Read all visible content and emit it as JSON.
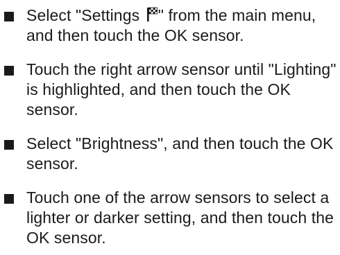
{
  "steps": [
    {
      "before_icon": "Select \"Settings ",
      "icon": "settings-flag-icon",
      "after_icon": "\" from the main menu, and then touch the OK sensor."
    },
    {
      "text": "Touch the right arrow sensor until \"Lighting\" is highlighted, and then touch the OK sensor."
    },
    {
      "text": "Select \"Brightness\", and then touch the OK sensor."
    },
    {
      "text": "Touch one of the arrow sensors to select a lighter or darker setting, and then touch the OK sensor."
    }
  ],
  "colors": {
    "text": "#1a1a1a",
    "background": "#ffffff"
  }
}
